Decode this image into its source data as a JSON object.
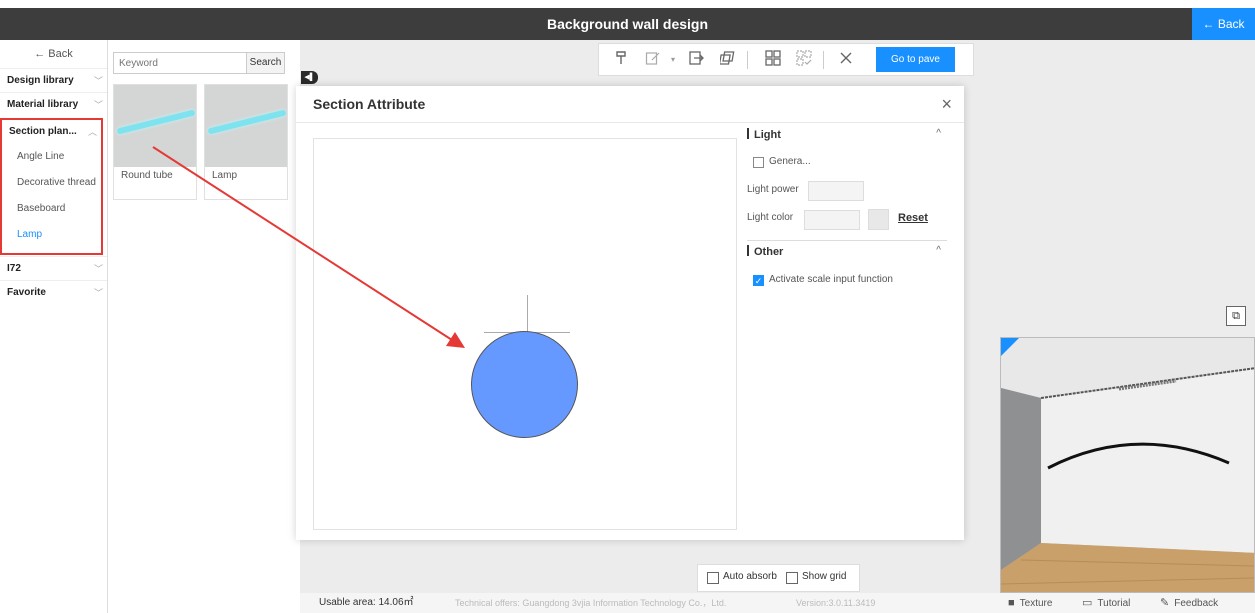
{
  "window": {
    "title": "Background wall design",
    "back_label": "← Back"
  },
  "sidebar": {
    "back_label": "← Back",
    "items": [
      {
        "label": "Design library"
      },
      {
        "label": "Material library"
      },
      {
        "label": "Section plan..."
      },
      {
        "label": "I72"
      },
      {
        "label": "Favorite"
      }
    ],
    "subitems": [
      "Angle  Line",
      "Decorative thread",
      "Baseboard",
      "Lamp"
    ],
    "active_subitem": "Lamp"
  },
  "panel": {
    "search_placeholder": "Keyword",
    "search_button": "Search",
    "cards": [
      {
        "label": "Round tube"
      },
      {
        "label": "Lamp"
      }
    ]
  },
  "toolbar": {
    "icons": [
      "brush-icon",
      "edit-icon",
      "exit-icon",
      "copy-icon",
      "group-icon",
      "ungroup-icon",
      "close-icon"
    ],
    "go_pave_label": "Go to pave"
  },
  "dialog": {
    "title": "Section Attribute",
    "close_glyph": "×",
    "light": {
      "heading": "Light",
      "caret": "^",
      "general_label": "Genera...",
      "power_label": "Light power",
      "color_label": "Light color",
      "reset_label": "Reset"
    },
    "other": {
      "heading": "Other",
      "caret": "^",
      "scale_label": "Activate scale input function",
      "scale_checked": true
    }
  },
  "bottom_options": {
    "auto_absorb": "Auto absorb",
    "show_grid": "Show grid"
  },
  "status": {
    "usable_area": "Usable area: 14.06㎡",
    "technical": "Technical offers: Guangdong 3vjia Information Technology Co.，Ltd.",
    "version": "Version:3.0.11.3419",
    "texture": "Texture",
    "tutorial": "Tutorial",
    "feedback": "Feedback"
  },
  "colors": {
    "accent": "#1890ff",
    "highlight_border": "#e53935",
    "profile_fill": "#6699ff",
    "titlebar_bg": "#3d3d3d",
    "tube_color": "#7ee3ef"
  }
}
